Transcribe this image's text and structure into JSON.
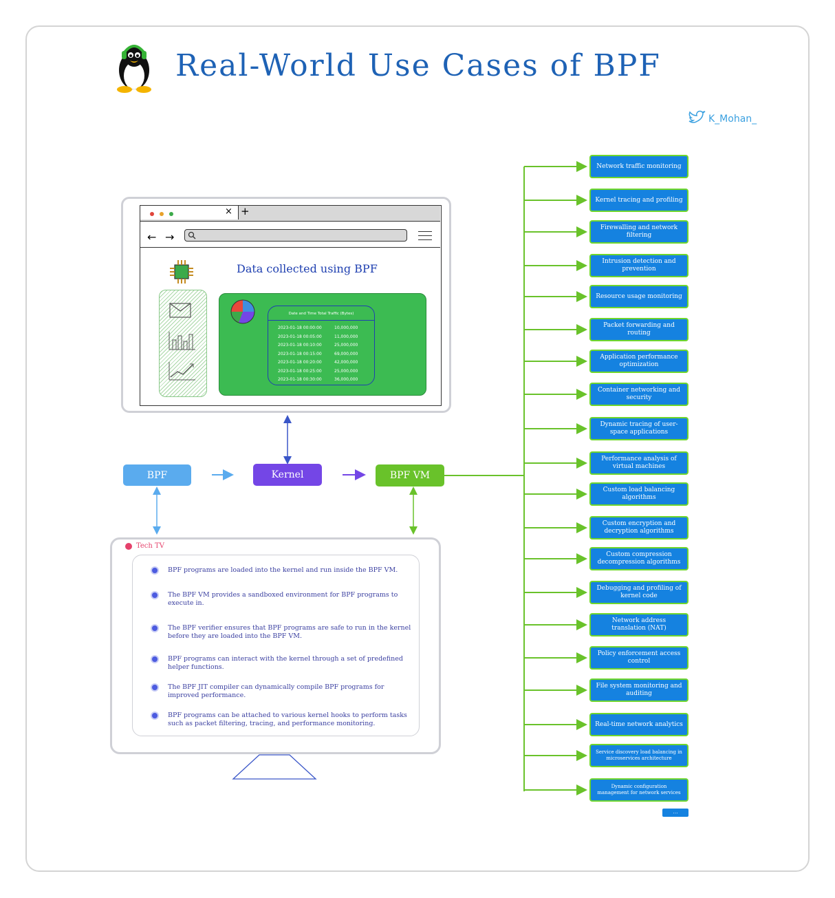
{
  "title": "Real-World Use Cases of BPF",
  "author": "K_Mohan_",
  "browser": {
    "heading": "Data collected using BPF",
    "table": {
      "header": "Date and Time Total Traffic (Bytes)",
      "rows": [
        [
          "2023-01-18 00:00:00",
          "10,000,000"
        ],
        [
          "2023-01-18 00:05:00",
          "11,000,000"
        ],
        [
          "2023-01-18 00:10:00",
          "25,000,000"
        ],
        [
          "2023-01-18 00:15:00",
          "69,000,000"
        ],
        [
          "2023-01-18 00:20:00",
          "42,000,000"
        ],
        [
          "2023-01-18 00:25:00",
          "25,000,000"
        ],
        [
          "2023-01-18 00:30:00",
          "36,000,000"
        ]
      ]
    }
  },
  "flow": {
    "bpf": "BPF",
    "kernel": "Kernel",
    "bpfvm": "BPF VM"
  },
  "tv": {
    "label": "Tech TV",
    "facts": [
      "BPF programs are loaded into the kernel and run inside the BPF VM.",
      "The BPF VM provides a sandboxed environment for BPF programs to execute in.",
      "The BPF verifier ensures that BPF programs are safe to run in the kernel before they are loaded into the BPF VM.",
      "BPF programs can interact with the kernel through a set of predefined helper functions.",
      "The BPF JIT compiler can dynamically compile BPF programs for improved performance.",
      "BPF programs can be attached to various kernel hooks to perform tasks such as packet filtering, tracing, and performance monitoring."
    ]
  },
  "use_cases": [
    "Network traffic monitoring",
    "Kernel tracing and profiling",
    "Firewalling and network filtering",
    "Intrusion detection and prevention",
    "Resource usage monitoring",
    "Packet forwarding and routing",
    "Application performance optimization",
    "Container networking and security",
    "Dynamic tracing of user-space applications",
    "Performance analysis of virtual machines",
    "Custom load balancing algorithms",
    "Custom encryption and decryption algorithms",
    "Custom compression decompression algorithms",
    "Debugging and profiling of kernel code",
    "Network address translation (NAT)",
    "Policy enforcement access control",
    "File system monitoring and auditing",
    "Real-time network analytics",
    "Service discovery load balancing in microservices architecture",
    "Dynamic configuration management for network services"
  ],
  "more_label": "...",
  "colors": {
    "bpf": "#5aabee",
    "kernel": "#7446e6",
    "bpfvm": "#69c22a",
    "use_case_fill": "#1582e0",
    "use_case_border": "#6fd62c",
    "title": "#1e62b5"
  }
}
